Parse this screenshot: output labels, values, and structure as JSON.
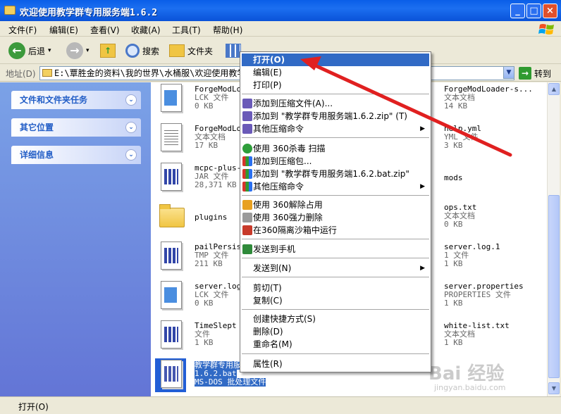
{
  "window": {
    "title": "欢迎使用教学群专用服务端1.6.2",
    "min": "_",
    "max": "□",
    "close": "×"
  },
  "menubar": [
    "文件(F)",
    "编辑(E)",
    "查看(V)",
    "收藏(A)",
    "工具(T)",
    "帮助(H)"
  ],
  "toolbar": {
    "back": "后退",
    "back_drop": "▾",
    "forward_drop": "▾",
    "search": "搜索",
    "folders": "文件夹"
  },
  "address": {
    "label": "地址(D)",
    "value": "E:\\覃胜金的资料\\我的世界\\水桶服\\欢迎使用教学",
    "go": "转到"
  },
  "leftpane": {
    "panels": [
      "文件和文件夹任务",
      "其它位置",
      "详细信息"
    ]
  },
  "files": [
    {
      "name": "ForgeModLoa",
      "type": "LCK 文件",
      "size": "0 KB",
      "icon": "lck"
    },
    {
      "name": "ForgeModLoa",
      "type": "文本文档",
      "size": "17 KB",
      "icon": "txt"
    },
    {
      "name": "mcpc-plus-1",
      "type": "JAR 文件",
      "size": "28,371 KB",
      "icon": "bat"
    },
    {
      "name": "plugins",
      "type": "",
      "size": "",
      "icon": "folder"
    },
    {
      "name": "pailPersist",
      "type": "TMP 文件",
      "size": "211 KB",
      "icon": "bat"
    },
    {
      "name": "server.log.",
      "type": "LCK 文件",
      "size": "0 KB",
      "icon": "lck"
    },
    {
      "name": "TimeSlept",
      "type": "文件",
      "size": "1 KB",
      "icon": "bat"
    },
    {
      "name": "ForgeModLoader-s...",
      "type": "文本文档",
      "size": "14 KB",
      "icon": "txt"
    },
    {
      "name": "help.yml",
      "type": "YML 文件",
      "size": "3 KB",
      "icon": "txt"
    },
    {
      "name": "mods",
      "type": "",
      "size": "",
      "icon": "folder"
    },
    {
      "name": "ops.txt",
      "type": "文本文档",
      "size": "0 KB",
      "icon": "txt"
    },
    {
      "name": "server.log.1",
      "type": "1 文件",
      "size": "1 KB",
      "icon": "txt"
    },
    {
      "name": "server.properties",
      "type": "PROPERTIES 文件",
      "size": "1 KB",
      "icon": "txt"
    },
    {
      "name": "white-list.txt",
      "type": "文本文档",
      "size": "1 KB",
      "icon": "txt"
    }
  ],
  "selected_file": {
    "name": "教学群专用服",
    "type": "1.6.2.bat",
    "size": "MS-DOS 批处理文件"
  },
  "context_menu": [
    {
      "label": "打开(O)",
      "selected": true
    },
    {
      "label": "编辑(E)"
    },
    {
      "label": "打印(P)"
    },
    {
      "label": "添加到压缩文件(A)..."
    },
    {
      "label": "添加到 \"教学群专用服务端1.6.2.zip\" (T)"
    },
    {
      "label": "其他压缩命令",
      "submenu": true
    },
    {
      "label": "使用 360杀毒 扫描"
    },
    {
      "label": "增加到压缩包..."
    },
    {
      "label": "添加到 \"教学群专用服务端1.6.2.bat.zip\""
    },
    {
      "label": "其他压缩命令",
      "submenu": true
    },
    {
      "label": "使用 360解除占用"
    },
    {
      "label": "使用 360强力删除"
    },
    {
      "label": "在360隔离沙箱中运行"
    },
    {
      "label": "发送到手机"
    },
    {
      "label": "发送到(N)",
      "submenu": true
    },
    {
      "label": "剪切(T)"
    },
    {
      "label": "复制(C)"
    },
    {
      "label": "创建快捷方式(S)"
    },
    {
      "label": "删除(D)"
    },
    {
      "label": "重命名(M)"
    },
    {
      "label": "属性(R)"
    }
  ],
  "submenu_arrow": "▶",
  "status": "打开(O)",
  "watermark": "Bai 经验",
  "watermark_url": "jingyan.baidu.com",
  "colors": {
    "title_blue": "#0a5ee8",
    "highlight": "#316ac5",
    "arrow_red": "#e02020"
  }
}
